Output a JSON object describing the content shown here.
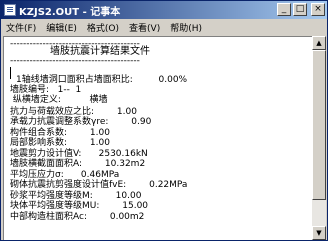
{
  "window": {
    "title": "KZJS2.OUT - 记事本",
    "minimize_symbol": "_",
    "maximize_symbol": "□",
    "close_symbol": "×"
  },
  "menu": {
    "file": "文件(F)",
    "edit": "编辑(E)",
    "format": "格式(O)",
    "view": "查看(V)",
    "help": "帮助(H)"
  },
  "scrollbar": {
    "up_arrow": "▲",
    "down_arrow": "▼"
  },
  "content": {
    "separator_top": "----------------------------------------",
    "heading": "墙肢抗震计算结果文件",
    "separator_bottom": "----------------------------------------",
    "lines": [
      "1轴线墙洞口面积占墙面积比:         0.00%",
      "墙肢编号:   1--  1",
      " 纵横墙定义:          横墙",
      "抗力与荷载效应之比:        1.00",
      "承载力抗震调整系数γre:        0.90",
      "构件组合系数:        1.00",
      "局部影响系数:        1.00",
      "地震剪力设计值V:      2530.16kN",
      "墙肢横截面面积A:        10.32m2",
      "平均压应力σ:      0.46MPa",
      "砌体抗震抗剪强度设计值fvE:        0.22MPa",
      "砂浆平均强度等级M:        10.00",
      "块体平均强度等级MU:        15.00",
      "中部构造柱面积Ac:        0.00m2"
    ]
  }
}
